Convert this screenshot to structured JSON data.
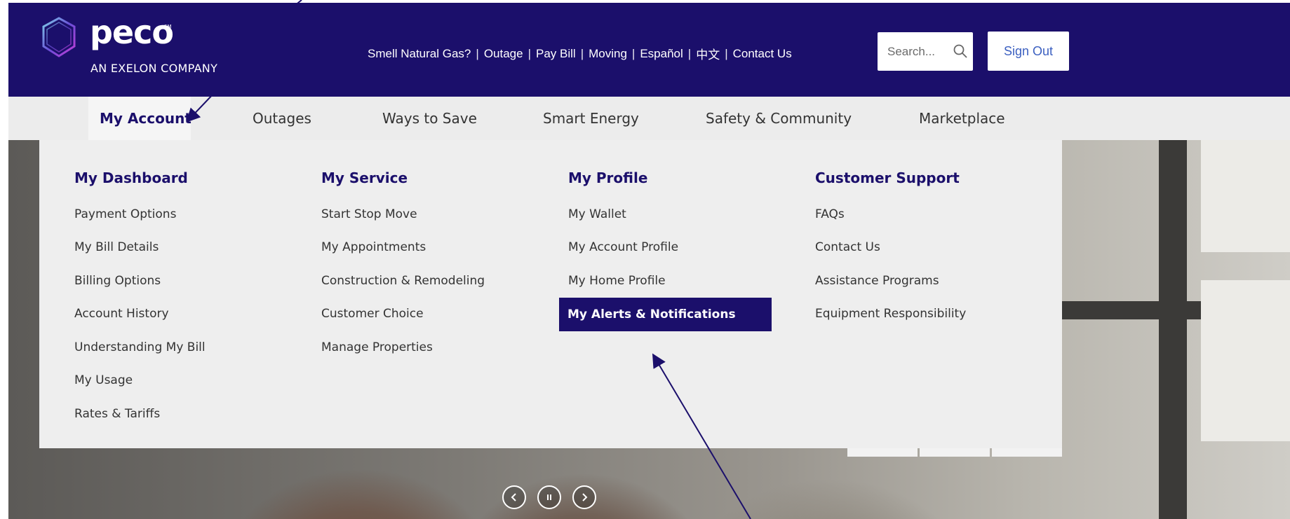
{
  "brand": {
    "logo_word": "peco",
    "logo_sm": "SM",
    "tagline": "AN EXELON COMPANY"
  },
  "utility_links": [
    "Smell Natural Gas?",
    "Outage",
    "Pay Bill",
    "Moving",
    "Español",
    "中文",
    "Contact Us"
  ],
  "search": {
    "placeholder": "Search..."
  },
  "sign_out": "Sign Out",
  "main_nav": {
    "items": [
      "My Account",
      "Outages",
      "Ways to Save",
      "Smart Energy",
      "Safety & Community",
      "Marketplace"
    ],
    "active": "My Account"
  },
  "dropdown": {
    "columns": [
      {
        "heading": "My Dashboard",
        "links": [
          "Payment Options",
          "My Bill Details",
          "Billing Options",
          "Account History",
          "Understanding My Bill",
          "My Usage",
          "Rates & Tariffs"
        ]
      },
      {
        "heading": "My Service",
        "links": [
          "Start Stop Move",
          "My Appointments",
          "Construction & Remodeling",
          "Customer Choice",
          "Manage Properties"
        ]
      },
      {
        "heading": "My Profile",
        "links": [
          "My Wallet",
          "My Account Profile",
          "My Home Profile",
          "My Alerts & Notifications"
        ]
      },
      {
        "heading": "Customer Support",
        "links": [
          "FAQs",
          "Contact Us",
          "Assistance Programs",
          "Equipment Responsibility"
        ]
      }
    ],
    "highlighted_link": "My Alerts & Notifications"
  },
  "carousel_controls": [
    "previous-icon",
    "pause-icon",
    "next-icon"
  ],
  "colors": {
    "brand_navy": "#1b0f6b",
    "nav_bg": "#ececec",
    "link_blue": "#3b5fc0",
    "annotation_arrow": "#1b0f6b"
  }
}
